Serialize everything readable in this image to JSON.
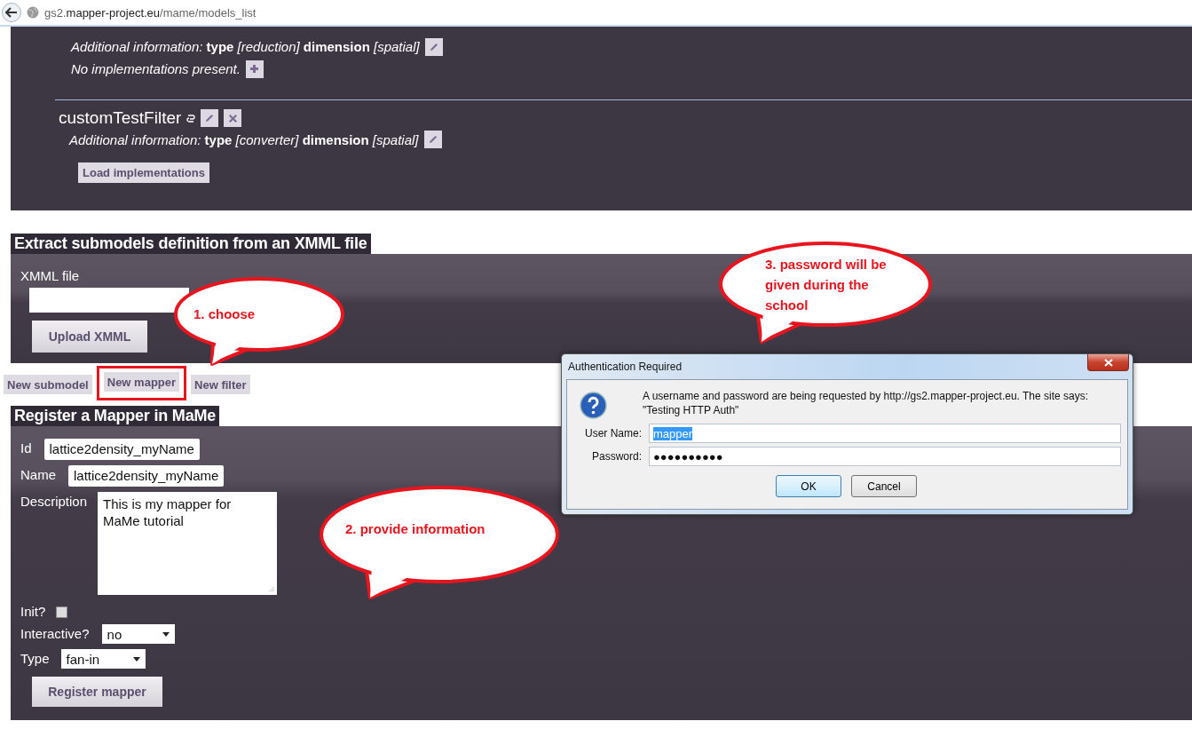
{
  "address_bar": {
    "host_prefix": "gs2.",
    "host": "mapper-project.eu",
    "path": "/mame/models_list"
  },
  "filters": [
    {
      "kind": "partial",
      "info_label": "Additional information:",
      "type_label": "type",
      "type_value": "[reduction]",
      "dimension_label": "dimension",
      "dimension_value": "[spatial]",
      "note": "No implementations present."
    },
    {
      "kind": "full",
      "name": "customTestFilter",
      "info_label": "Additional information:",
      "type_label": "type",
      "type_value": "[converter]",
      "dimension_label": "dimension",
      "dimension_value": "[spatial]",
      "action": "Load implementations"
    }
  ],
  "extract_section": {
    "title": "Extract submodels definition from an XMML file",
    "file_label": "XMML file",
    "upload_button": "Upload XMML"
  },
  "new_buttons": [
    {
      "label": "New submodel",
      "highlighted": false
    },
    {
      "label": "New mapper",
      "highlighted": true
    },
    {
      "label": "New filter",
      "highlighted": false
    }
  ],
  "register_section": {
    "title": "Register a Mapper in MaMe",
    "fields": [
      {
        "kind": "text",
        "label": "Id",
        "value": "lattice2density_myName"
      },
      {
        "kind": "text",
        "label": "Name",
        "value": "lattice2density_myName"
      },
      {
        "kind": "textarea",
        "label": "Description",
        "value": "This is my mapper for\nMaMe tutorial"
      },
      {
        "kind": "checkbox",
        "label": "Init?",
        "checked": false
      },
      {
        "kind": "select",
        "label": "Interactive?",
        "value": "no"
      },
      {
        "kind": "select",
        "label": "Type",
        "value": "fan-in"
      }
    ],
    "submit_button": "Register mapper"
  },
  "callouts": [
    {
      "text": "1. choose"
    },
    {
      "text": "2. provide information"
    },
    {
      "text": "3. password will be given during the school"
    }
  ],
  "dialog": {
    "title": "Authentication Required",
    "message_lines": [
      "A username and password are being requested by http://gs2.mapper-project.eu. The site says:",
      "\"Testing HTTP Auth\""
    ],
    "fields": [
      {
        "label": "User Name:",
        "value": "mapper",
        "text_selected": true
      },
      {
        "label": "Password:",
        "value": "●●●●●●●●●●",
        "text_selected": false
      }
    ],
    "buttons": [
      {
        "label": "OK",
        "default": true
      },
      {
        "label": "Cancel",
        "default": false
      }
    ]
  }
}
